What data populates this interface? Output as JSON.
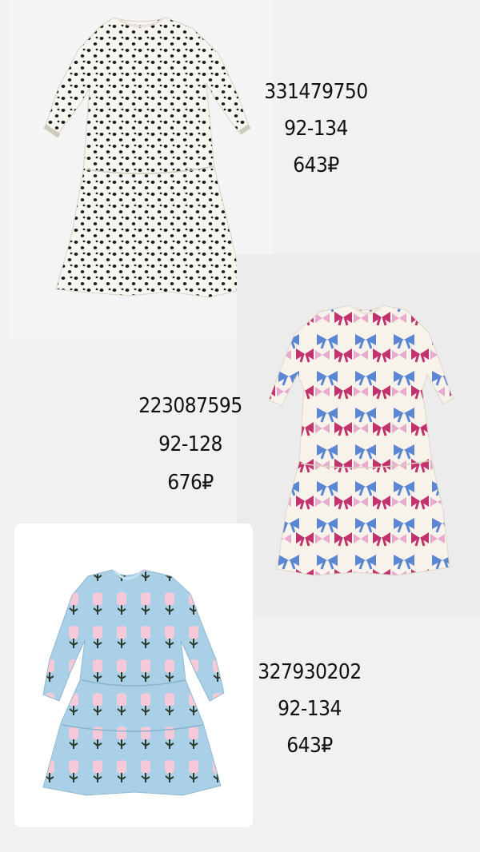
{
  "products": [
    {
      "article": "331479750",
      "sizes": "92-134",
      "price": "643₽",
      "print": "dots"
    },
    {
      "article": "223087595",
      "sizes": "92-128",
      "price": "676₽",
      "print": "bows"
    },
    {
      "article": "327930202",
      "sizes": "92-134",
      "price": "643₽",
      "print": "tulips"
    }
  ],
  "colors": {
    "dots_bg": "#f7f5ef",
    "dots": "#1a1a1a",
    "bows_bg": "#f8f3ea",
    "bow_pink": "#e8a9cf",
    "bow_magenta": "#c1336e",
    "bow_blue": "#5b87d2",
    "tulip_bg": "#a9d0e6",
    "tulip": "#f6c9d8",
    "leaf": "#2c3b2e"
  }
}
